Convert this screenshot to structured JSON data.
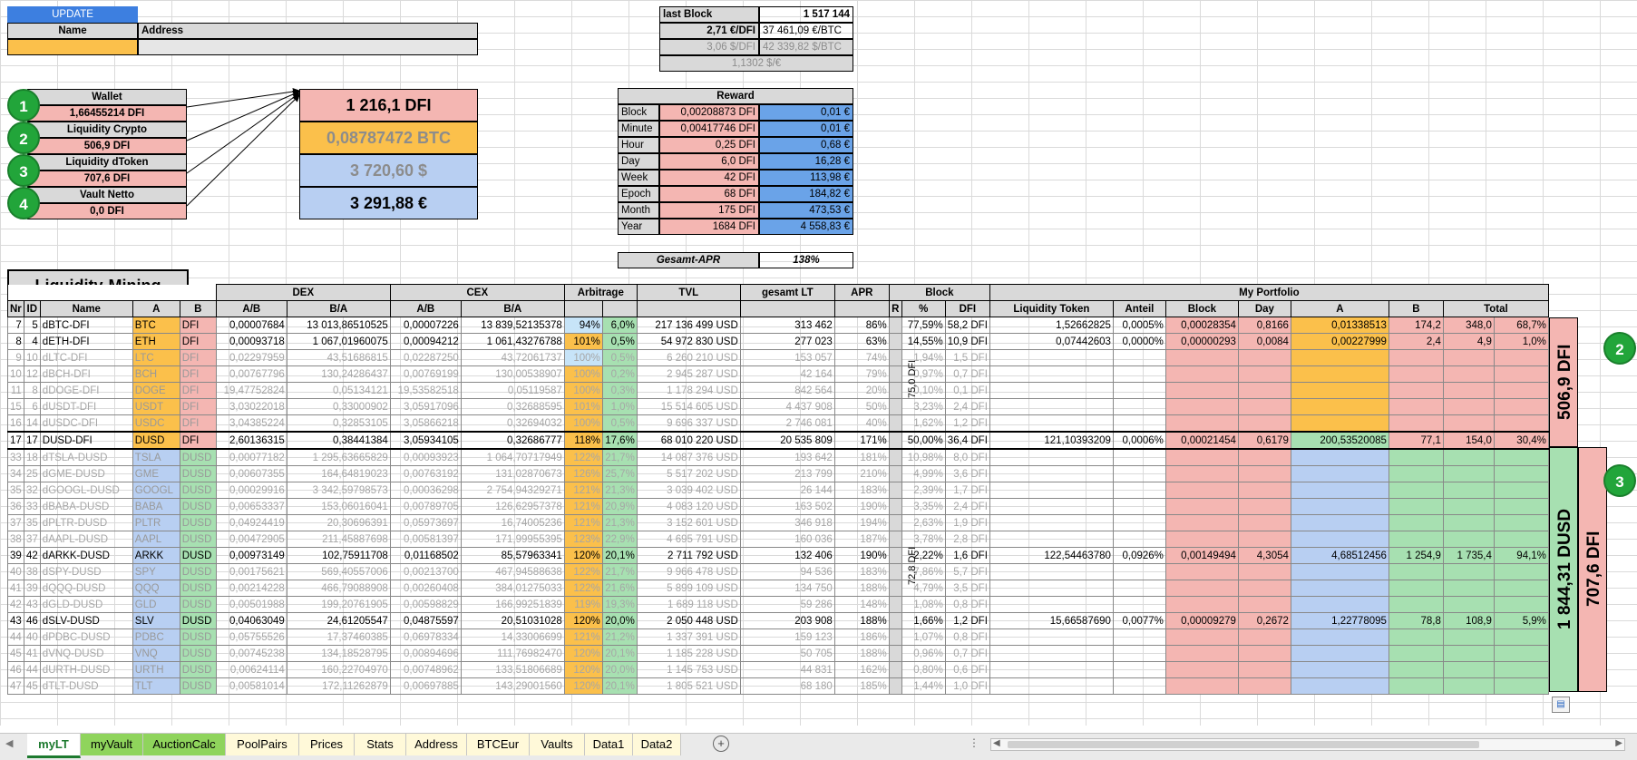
{
  "app": {
    "update_label": "UPDATE",
    "name_header": "Name",
    "address_header": "Address"
  },
  "info": {
    "last_block_label": "last Block",
    "last_block_value": "1 517 144",
    "eur_dfi": "2,71 €/DFI",
    "eur_btc": "37 461,09 €/BTC",
    "usd_dfi": "3,06 $/DFI",
    "usd_btc": "42 339,82 $/BTC",
    "usd_eur": "1,1302 $/€"
  },
  "wallet": {
    "items": [
      {
        "num": "1",
        "label": "Wallet",
        "value": "1,66455214 DFI"
      },
      {
        "num": "2",
        "label": "Liquidity Crypto",
        "value": "506,9 DFI"
      },
      {
        "num": "3",
        "label": "Liquidity dToken",
        "value": "707,6 DFI"
      },
      {
        "num": "4",
        "label": "Vault Netto",
        "value": "0,0 DFI"
      }
    ],
    "total_dfi": "1 216,1 DFI",
    "total_btc": "0,08787472 BTC",
    "total_usd": "3 720,60 $",
    "total_eur": "3 291,88 €"
  },
  "reward": {
    "title": "Reward",
    "rows": [
      {
        "label": "Block",
        "dfi": "0,00208873 DFI",
        "eur": "0,01 €"
      },
      {
        "label": "Minute",
        "dfi": "0,00417746 DFI",
        "eur": "0,01 €"
      },
      {
        "label": "Hour",
        "dfi": "0,25 DFI",
        "eur": "0,68 €"
      },
      {
        "label": "Day",
        "dfi": "6,0 DFI",
        "eur": "16,28 €"
      },
      {
        "label": "Week",
        "dfi": "42 DFI",
        "eur": "113,98 €"
      },
      {
        "label": "Epoch",
        "dfi": "68 DFI",
        "eur": "184,82 €"
      },
      {
        "label": "Month",
        "dfi": "175 DFI",
        "eur": "473,53 €"
      },
      {
        "label": "Year",
        "dfi": "1684 DFI",
        "eur": "4 558,83 €"
      }
    ],
    "apr_label": "Gesamt-APR",
    "apr_value": "138%"
  },
  "lm": {
    "title": "Liquidity-Mining",
    "groups": {
      "dex": "DEX",
      "cex": "CEX",
      "arb": "Arbitrage",
      "tvl": "TVL",
      "lt": "gesamt LT",
      "apr": "APR",
      "block": "Block",
      "portfolio": "My Portfolio"
    },
    "headers": [
      "Nr",
      "ID",
      "Name",
      "A",
      "B",
      "A/B",
      "B/A",
      "A/B",
      "B/A",
      "",
      "",
      "",
      "",
      "",
      "R",
      "%",
      "DFI",
      "Liquidity Token",
      "Anteil",
      "Block",
      "Day",
      "A",
      "B",
      "",
      ""
    ],
    "total_header": "Total",
    "r_crypto": "75,0 DFI",
    "r_dtoken": "72,8 DFI",
    "side_crypto": "506,9 DFI",
    "side_dusd": "1 844,31 DUSD",
    "side_dtoken": "707,6 DFI",
    "rows": [
      {
        "cells": [
          "7",
          "5",
          "dBTC-DFI",
          "BTC",
          "DFI",
          "0,00007684",
          "13 013,86510525",
          "0,00007226",
          "13 839,52135378",
          "94%",
          "6,0%",
          "217 136 499 USD",
          "313 462",
          "86%",
          "",
          "77,59%",
          "58,2 DFI",
          "1,52662825",
          "0,0005%",
          "0,00028354",
          "0,8166",
          "0,01338513",
          "174,2",
          "348,0",
          "68,7%"
        ],
        "g": "c",
        "a": 1
      },
      {
        "cells": [
          "8",
          "4",
          "dETH-DFI",
          "ETH",
          "DFI",
          "0,00093718",
          "1 067,01960075",
          "0,00094212",
          "1 061,43276788",
          "101%",
          "0,5%",
          "54 972 830 USD",
          "277 023",
          "63%",
          "",
          "14,55%",
          "10,9 DFI",
          "0,07442603",
          "0,0000%",
          "0,00000293",
          "0,0084",
          "0,00227999",
          "2,4",
          "4,9",
          "1,0%"
        ],
        "g": "c",
        "a": 1
      },
      {
        "cells": [
          "9",
          "10",
          "dLTC-DFI",
          "LTC",
          "DFI",
          "0,02297959",
          "43,51686815",
          "0,02287250",
          "43,72061737",
          "100%",
          "0,5%",
          "6 260 210 USD",
          "153 057",
          "74%",
          "",
          "1,94%",
          "1,5 DFI",
          "",
          "",
          "",
          "",
          "",
          "",
          "",
          ""
        ],
        "g": "c",
        "a": 0
      },
      {
        "cells": [
          "10",
          "12",
          "dBCH-DFI",
          "BCH",
          "DFI",
          "0,00767796",
          "130,24286437",
          "0,00769199",
          "130,00538907",
          "100%",
          "0,2%",
          "2 945 287 USD",
          "42 164",
          "79%",
          "",
          "0,97%",
          "0,7 DFI",
          "",
          "",
          "",
          "",
          "",
          "",
          "",
          ""
        ],
        "g": "c",
        "a": 0
      },
      {
        "cells": [
          "11",
          "8",
          "dDOGE-DFI",
          "DOGE",
          "DFI",
          "19,47752824",
          "0,05134121",
          "19,53582518",
          "0,05119587",
          "100%",
          "0,3%",
          "1 178 294 USD",
          "842 564",
          "20%",
          "",
          "0,10%",
          "0,1 DFI",
          "",
          "",
          "",
          "",
          "",
          "",
          "",
          ""
        ],
        "g": "c",
        "a": 0
      },
      {
        "cells": [
          "15",
          "6",
          "dUSDT-DFI",
          "USDT",
          "DFI",
          "3,03022018",
          "0,33000902",
          "3,05917096",
          "0,32688595",
          "101%",
          "1,0%",
          "15 514 605 USD",
          "4 437 908",
          "50%",
          "",
          "3,23%",
          "2,4 DFI",
          "",
          "",
          "",
          "",
          "",
          "",
          "",
          ""
        ],
        "g": "c",
        "a": 0
      },
      {
        "cells": [
          "16",
          "14",
          "dUSDC-DFI",
          "USDC",
          "DFI",
          "3,04385224",
          "0,32853105",
          "3,05866218",
          "0,32694032",
          "100%",
          "0,5%",
          "9 696 337 USD",
          "2 746 081",
          "40%",
          "",
          "1,62%",
          "1,2 DFI",
          "",
          "",
          "",
          "",
          "",
          "",
          "",
          ""
        ],
        "g": "c",
        "a": 0
      },
      {
        "cells": [
          "17",
          "17",
          "DUSD-DFI",
          "DUSD",
          "DFI",
          "2,60136315",
          "0,38441384",
          "3,05934105",
          "0,32686777",
          "118%",
          "17,6%",
          "68 010 220 USD",
          "20 535 809",
          "171%",
          "",
          "50,00%",
          "36,4 DFI",
          "121,10393209",
          "0,0006%",
          "0,00021454",
          "0,6179",
          "200,53520085",
          "77,1",
          "154,0",
          "30,4%"
        ],
        "g": "d",
        "a": 1
      },
      {
        "cells": [
          "33",
          "18",
          "dTSLA-DUSD",
          "TSLA",
          "DUSD",
          "0,00077182",
          "1 295,63665829",
          "0,00093923",
          "1 064,70717949",
          "122%",
          "21,7%",
          "14 087 376 USD",
          "193 642",
          "181%",
          "",
          "10,98%",
          "8,0 DFI",
          "",
          "",
          "",
          "",
          "",
          "",
          "",
          ""
        ],
        "g": "s",
        "a": 0
      },
      {
        "cells": [
          "34",
          "25",
          "dGME-DUSD",
          "GME",
          "DUSD",
          "0,00607355",
          "164,64819023",
          "0,00763192",
          "131,02870673",
          "126%",
          "25,7%",
          "5 517 202 USD",
          "213 799",
          "210%",
          "",
          "4,99%",
          "3,6 DFI",
          "",
          "",
          "",
          "",
          "",
          "",
          "",
          ""
        ],
        "g": "s",
        "a": 0
      },
      {
        "cells": [
          "35",
          "32",
          "dGOOGL-DUSD",
          "GOOGL",
          "DUSD",
          "0,00029916",
          "3 342,59798573",
          "0,00036298",
          "2 754,94329271",
          "121%",
          "21,3%",
          "3 039 402 USD",
          "26 144",
          "183%",
          "",
          "2,39%",
          "1,7 DFI",
          "",
          "",
          "",
          "",
          "",
          "",
          "",
          ""
        ],
        "g": "s",
        "a": 0
      },
      {
        "cells": [
          "36",
          "33",
          "dBABA-DUSD",
          "BABA",
          "DUSD",
          "0,00653337",
          "153,06016041",
          "0,00789705",
          "126,62957378",
          "121%",
          "20,9%",
          "4 083 120 USD",
          "163 502",
          "190%",
          "",
          "3,35%",
          "2,4 DFI",
          "",
          "",
          "",
          "",
          "",
          "",
          "",
          ""
        ],
        "g": "s",
        "a": 0
      },
      {
        "cells": [
          "37",
          "35",
          "dPLTR-DUSD",
          "PLTR",
          "DUSD",
          "0,04924419",
          "20,30696391",
          "0,05973697",
          "16,74005236",
          "121%",
          "21,3%",
          "3 152 601 USD",
          "346 918",
          "194%",
          "",
          "2,63%",
          "1,9 DFI",
          "",
          "",
          "",
          "",
          "",
          "",
          "",
          ""
        ],
        "g": "s",
        "a": 0
      },
      {
        "cells": [
          "38",
          "37",
          "dAAPL-DUSD",
          "AAPL",
          "DUSD",
          "0,00472905",
          "211,45887698",
          "0,00581397",
          "171,99955395",
          "123%",
          "22,9%",
          "4 695 791 USD",
          "160 036",
          "187%",
          "",
          "3,78%",
          "2,8 DFI",
          "",
          "",
          "",
          "",
          "",
          "",
          "",
          ""
        ],
        "g": "s",
        "a": 0
      },
      {
        "cells": [
          "39",
          "42",
          "dARKK-DUSD",
          "ARKK",
          "DUSD",
          "0,00973149",
          "102,75911708",
          "0,01168502",
          "85,57963341",
          "120%",
          "20,1%",
          "2 711 792 USD",
          "132 406",
          "190%",
          "",
          "2,22%",
          "1,6 DFI",
          "122,54463780",
          "0,0926%",
          "0,00149494",
          "4,3054",
          "4,68512456",
          "1 254,9",
          "1 735,4",
          "94,1%"
        ],
        "g": "s",
        "a": 1
      },
      {
        "cells": [
          "40",
          "38",
          "dSPY-DUSD",
          "SPY",
          "DUSD",
          "0,00175621",
          "569,40557006",
          "0,00213700",
          "467,94588638",
          "122%",
          "21,7%",
          "9 966 478 USD",
          "94 536",
          "183%",
          "",
          "7,86%",
          "5,7 DFI",
          "",
          "",
          "",
          "",
          "",
          "",
          "",
          ""
        ],
        "g": "s",
        "a": 0
      },
      {
        "cells": [
          "41",
          "39",
          "dQQQ-DUSD",
          "QQQ",
          "DUSD",
          "0,00214228",
          "466,79088908",
          "0,00260408",
          "384,01275033",
          "122%",
          "21,6%",
          "5 899 109 USD",
          "134 750",
          "188%",
          "",
          "4,79%",
          "3,5 DFI",
          "",
          "",
          "",
          "",
          "",
          "",
          "",
          ""
        ],
        "g": "s",
        "a": 0
      },
      {
        "cells": [
          "42",
          "43",
          "dGLD-DUSD",
          "GLD",
          "DUSD",
          "0,00501988",
          "199,20761905",
          "0,00598829",
          "166,99251839",
          "119%",
          "19,3%",
          "1 689 118 USD",
          "59 286",
          "148%",
          "",
          "1,08%",
          "0,8 DFI",
          "",
          "",
          "",
          "",
          "",
          "",
          "",
          ""
        ],
        "g": "s",
        "a": 0
      },
      {
        "cells": [
          "43",
          "46",
          "dSLV-DUSD",
          "SLV",
          "DUSD",
          "0,04063049",
          "24,61205547",
          "0,04875597",
          "20,51031028",
          "120%",
          "20,0%",
          "2 050 448 USD",
          "203 908",
          "188%",
          "",
          "1,66%",
          "1,2 DFI",
          "15,66587690",
          "0,0077%",
          "0,00009279",
          "0,2672",
          "1,22778095",
          "78,8",
          "108,9",
          "5,9%"
        ],
        "g": "s",
        "a": 1
      },
      {
        "cells": [
          "44",
          "40",
          "dPDBC-DUSD",
          "PDBC",
          "DUSD",
          "0,05755526",
          "17,37460385",
          "0,06978334",
          "14,33006699",
          "121%",
          "21,2%",
          "1 337 391 USD",
          "159 123",
          "186%",
          "",
          "1,07%",
          "0,8 DFI",
          "",
          "",
          "",
          "",
          "",
          "",
          "",
          ""
        ],
        "g": "s",
        "a": 0
      },
      {
        "cells": [
          "45",
          "41",
          "dVNQ-DUSD",
          "VNQ",
          "DUSD",
          "0,00745238",
          "134,18528795",
          "0,00894696",
          "111,76982470",
          "120%",
          "20,1%",
          "1 185 228 USD",
          "50 705",
          "188%",
          "",
          "0,96%",
          "0,7 DFI",
          "",
          "",
          "",
          "",
          "",
          "",
          "",
          ""
        ],
        "g": "s",
        "a": 0
      },
      {
        "cells": [
          "46",
          "44",
          "dURTH-DUSD",
          "URTH",
          "DUSD",
          "0,00624114",
          "160,22704970",
          "0,00748962",
          "133,51806689",
          "120%",
          "20,0%",
          "1 145 753 USD",
          "44 831",
          "162%",
          "",
          "0,80%",
          "0,6 DFI",
          "",
          "",
          "",
          "",
          "",
          "",
          "",
          ""
        ],
        "g": "s",
        "a": 0
      },
      {
        "cells": [
          "47",
          "45",
          "dTLT-DUSD",
          "TLT",
          "DUSD",
          "0,00581014",
          "172,11262879",
          "0,00697885",
          "143,29001560",
          "120%",
          "20,1%",
          "1 805 521 USD",
          "68 180",
          "185%",
          "",
          "1,44%",
          "1,0 DFI",
          "",
          "",
          "",
          "",
          "",
          "",
          "",
          ""
        ],
        "g": "s",
        "a": 0
      }
    ]
  },
  "side_circles": {
    "two": "2",
    "three": "3"
  },
  "tabs": [
    {
      "label": "myLT",
      "style": "active"
    },
    {
      "label": "myVault",
      "style": "gr"
    },
    {
      "label": "AuctionCalc",
      "style": "gr"
    },
    {
      "label": "PoolPairs",
      "style": "y"
    },
    {
      "label": "Prices",
      "style": "y"
    },
    {
      "label": "Stats",
      "style": "y"
    },
    {
      "label": "Address",
      "style": "y"
    },
    {
      "label": "BTCEur",
      "style": "y"
    },
    {
      "label": "Vaults",
      "style": "y"
    },
    {
      "label": "Data1",
      "style": "y"
    },
    {
      "label": "Data2",
      "style": "y"
    }
  ],
  "icons": {
    "add_sheet": "plus-circle-icon",
    "scroll_left": "left-arrow-icon",
    "scroll_right": "right-arrow-icon",
    "paste_options": "paste-options-icon",
    "nav_prev": "triangle-left-icon",
    "nav_next": "triangle-right-icon"
  }
}
